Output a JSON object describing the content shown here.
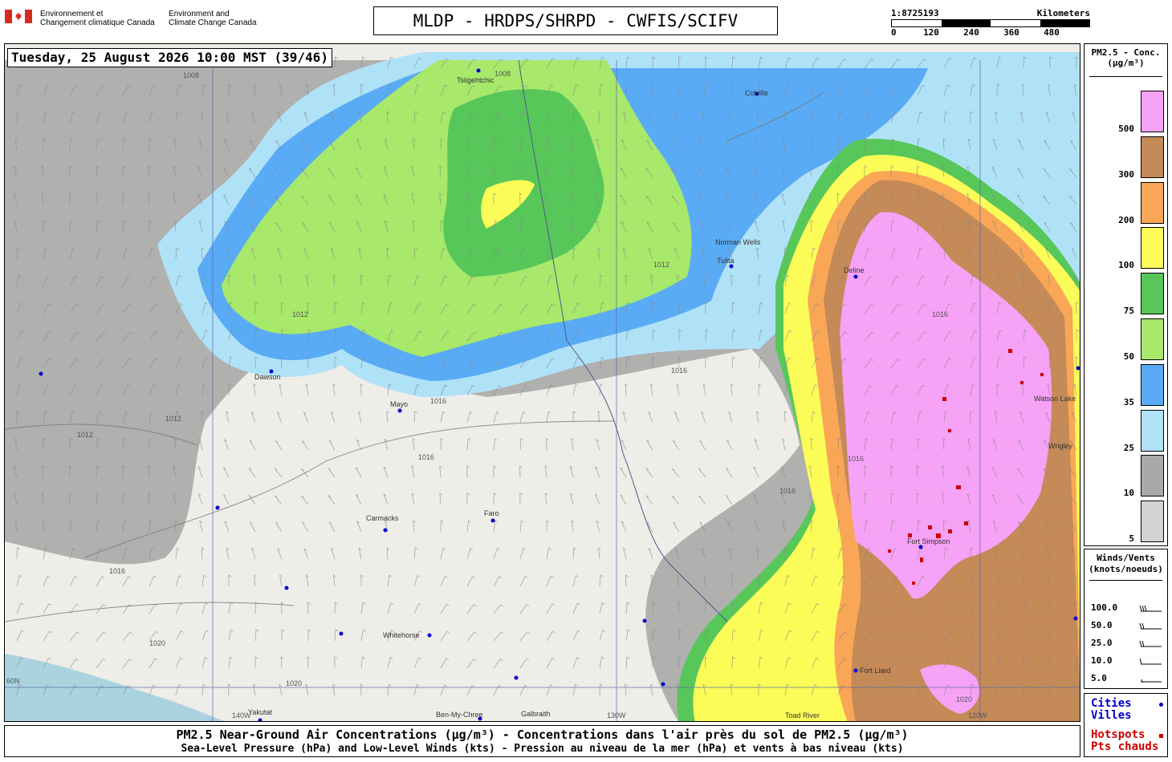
{
  "header": {
    "gov_fr_line1": "Environnement et",
    "gov_fr_line2": "Changement climatique Canada",
    "gov_en_line1": "Environment and",
    "gov_en_line2": "Climate Change Canada",
    "title": "MLDP - HRDPS/SHRPD - CWFIS/SCIFV",
    "scale_ratio": "1:8725193",
    "scale_unit": "Kilometers",
    "scale_ticks": [
      "0",
      "120",
      "240",
      "360",
      "480"
    ]
  },
  "map": {
    "datetime": "Tuesday, 25 August 2026 10:00 MST (39/46)",
    "cities": [
      {
        "name": "Tsiigehtchic"
      },
      {
        "name": "Colville"
      },
      {
        "name": "Norman Wells"
      },
      {
        "name": "Tulita"
      },
      {
        "name": "Deline"
      },
      {
        "name": "Dawson"
      },
      {
        "name": "Mayo"
      },
      {
        "name": "Carmacks"
      },
      {
        "name": "Faro"
      },
      {
        "name": "Whitehorse"
      },
      {
        "name": "Fort Liard"
      },
      {
        "name": "Fort Simpson"
      },
      {
        "name": "Watson Lake"
      },
      {
        "name": "Wrigley"
      },
      {
        "name": "Yakutat"
      },
      {
        "name": "Ben-My-Chree"
      },
      {
        "name": "Galbraith"
      },
      {
        "name": "Toad River"
      }
    ],
    "isobars": [
      "1008",
      "1008",
      "1012",
      "1012",
      "1012",
      "1012",
      "1016",
      "1016",
      "1016",
      "1016",
      "1016",
      "1016",
      "1016",
      "1020",
      "1020",
      "1020"
    ],
    "meridians": [
      "140W",
      "130W",
      "120W"
    ],
    "parallel": "60N",
    "colors": {
      "land": "#efede8",
      "c5": "#d3d3d3",
      "c10": "#a9a9a9",
      "c25": "#b0e2f7",
      "c35": "#5aabf5",
      "c50": "#a8e86a",
      "c75": "#57c75a",
      "c100": "#fcfc58",
      "c200": "#f9a656",
      "c300": "#c48a58",
      "c500": "#f6a2f6",
      "hotspot": "#cc0000",
      "city": "#0000cc"
    }
  },
  "legend": {
    "title_line1": "PM2.5 - Conc.",
    "title_line2": "(µg/m³)",
    "bins": [
      {
        "label": "500",
        "color": "#f6a2f6"
      },
      {
        "label": "300",
        "color": "#c48a58"
      },
      {
        "label": "200",
        "color": "#f9a656"
      },
      {
        "label": "100",
        "color": "#fcfc58"
      },
      {
        "label": "75",
        "color": "#57c75a"
      },
      {
        "label": "50",
        "color": "#a8e86a"
      },
      {
        "label": "35",
        "color": "#5aabf5"
      },
      {
        "label": "25",
        "color": "#b0e2f7"
      },
      {
        "label": "10",
        "color": "#a9a9a9"
      },
      {
        "label": "5",
        "color": "#d3d3d3"
      }
    ]
  },
  "winds": {
    "title_line1": "Winds/Vents",
    "title_line2": "(knots/noeuds)",
    "rows": [
      "100.0",
      "50.0",
      "25.0",
      "10.0",
      "5.0"
    ]
  },
  "keys": {
    "cities_en": "Cities",
    "cities_fr": "Villes",
    "hotspots_en": "Hotspots",
    "hotspots_fr": "Pts chauds"
  },
  "footer": {
    "line1": "PM2.5 Near-Ground Air Concentrations (µg/m³) - Concentrations dans l'air près du sol de PM2.5 (µg/m³)",
    "line2": "Sea-Level Pressure (hPa) and Low-Level Winds (kts) - Pression au niveau de la mer (hPa) et vents à bas niveau (kts)"
  }
}
